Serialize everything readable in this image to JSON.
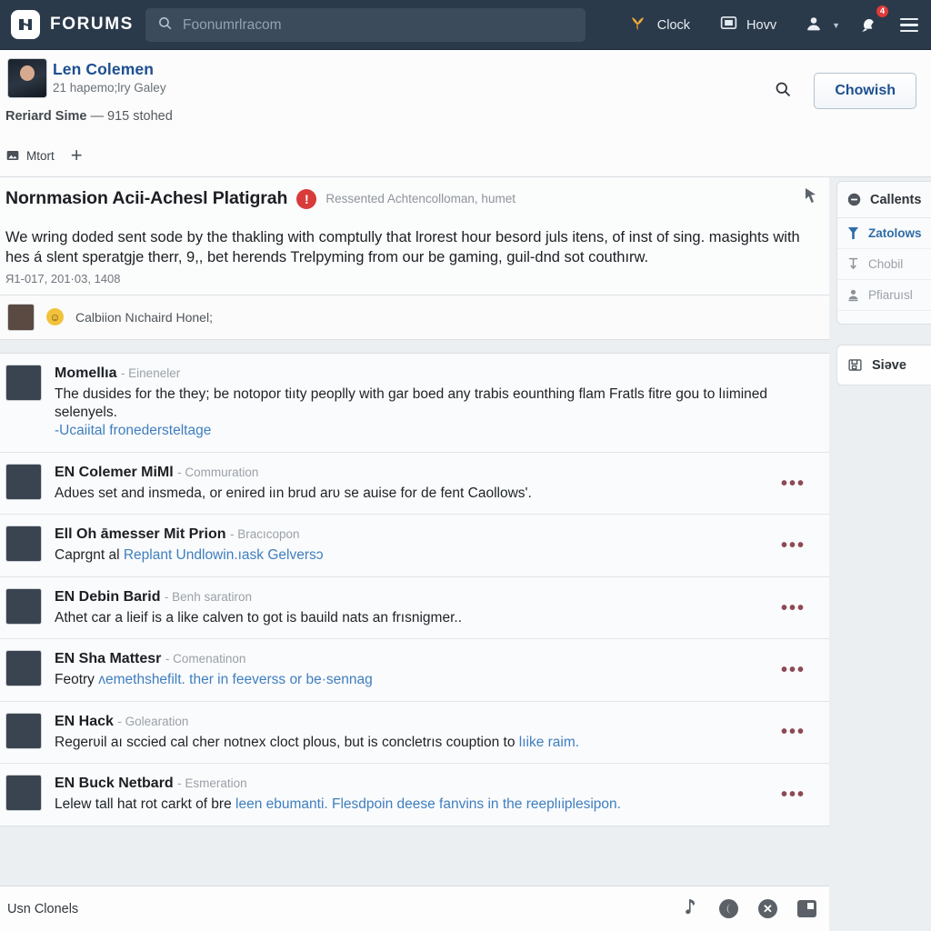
{
  "topnav": {
    "brand": "FORUMS",
    "brand_icon": "puzzle-logo-icon",
    "search": {
      "placeholder": "Foonumrlracom",
      "value": ""
    },
    "clock_label": "Clock",
    "how_label": "Hovv",
    "notification_count": "4",
    "icons": [
      "search-icon",
      "clock-icon",
      "monitor-icon",
      "account-icon",
      "chevron-down-icon",
      "notification-bell-icon",
      "hamburger-menu-icon"
    ]
  },
  "profile": {
    "name": "Len Colemen",
    "subtitle": "21 hapemo;lry Galey",
    "stats_bold": "Reriard Sime",
    "stats_rest": "— 915 stohed",
    "action_label": "Mtort",
    "add_label": "+",
    "search_icon": "search-icon",
    "primary_button": "Chowish"
  },
  "post": {
    "title": "Nornmasion Acii-Achesl Platigrah",
    "alert_badge": "!",
    "meta": "Ressented Achtencolloman, humet",
    "body": "We wring doded sent sode by the thakling with comptully that lrorest hour besord juls itens, of inst of sing. masights with hes á slent speratɡje therr, 9,, bet herends Trelpyming from our be gaming, guil-dnd sot couthırw.",
    "stamp": "Я1-017, 201·03, 1408",
    "cursor_icon": "mouse-cursor-icon",
    "subrow_text": "Calbiion Nıchaird Honel;",
    "subrow_emoji": "smile-emoji-icon"
  },
  "comments": [
    {
      "name": "Momellıa",
      "role": "- Eineneler",
      "body": "The dusides for the they; be notopor tiıty peoplly with gar boed any trabis eounthing flam Fratls fitre gou to lıimined selenyеls.",
      "link": "-Ucaiital fronedersteltage",
      "dots": false,
      "avatar": "f2"
    },
    {
      "name": "EN Colemer MiMl",
      "role": "- Commuration",
      "body": "Adʋes set and insmeda, or enired iın brud arʋ se auise for de fent Caollows'.",
      "link": "",
      "dots": true,
      "avatar": "f3"
    },
    {
      "name": "Ell Oh āmesser Mit Prion",
      "role": "- Bracıcopon",
      "body": "Caprgnt al ",
      "link": "Replant Undlowin.ıask Gelversɔ",
      "dots": true,
      "avatar": "f4"
    },
    {
      "name": "EN Debin Barid",
      "role": "- Benh saratiron",
      "body": "Athet car a lieif is a like calven to got is bauild nats an frısnigmer..",
      "link": "",
      "dots": true,
      "avatar": "f5"
    },
    {
      "name": "EN Sha Mattesr",
      "role": "- Comenatinon",
      "body": "Feotry ",
      "link": "ʌemethshefilt. ther in feeverss or be·sennag",
      "dots": true,
      "avatar": "f6"
    },
    {
      "name": "EN Hack",
      "role": "- Golearation",
      "body": "Regerʋil aı sccied cal cher notnex cloct plous, but is concletrıs couption to ",
      "link": "lıike raim.",
      "dots": true,
      "avatar": "f7"
    },
    {
      "name": "EN Buck Netbard",
      "role": "- Esmeration",
      "body": "Lelew tall hat rot carkt of bre ",
      "link": "leen ebumanti. Flesdpoin deese fanvins in the reeplıiplesipon.",
      "dots": true,
      "avatar": "f8"
    }
  ],
  "rail": {
    "head_label": "Callents",
    "head_icon": "minus-circle-icon",
    "items": [
      {
        "label": "Zatolows",
        "icon": "filter-icon",
        "state": "selected"
      },
      {
        "label": "Chobil",
        "icon": "sort-down-icon",
        "state": "dim"
      },
      {
        "label": "Pfiaruısl",
        "icon": "person-badge-icon",
        "state": "dim"
      }
    ],
    "card2_label": "Siəve",
    "card2_icon": "save-folder-icon"
  },
  "bottombar": {
    "label": "Usn Clonels",
    "icons": [
      "music-note-icon",
      "moon-circle-icon",
      "close-circle-icon",
      "archive-box-icon"
    ]
  },
  "colors": {
    "nav_bg": "#2b3a4a",
    "accent_link": "#1d4f91",
    "alert_red": "#d93b3b",
    "badge_red": "#e03a3a",
    "dots_maroon": "#8c4a55"
  }
}
